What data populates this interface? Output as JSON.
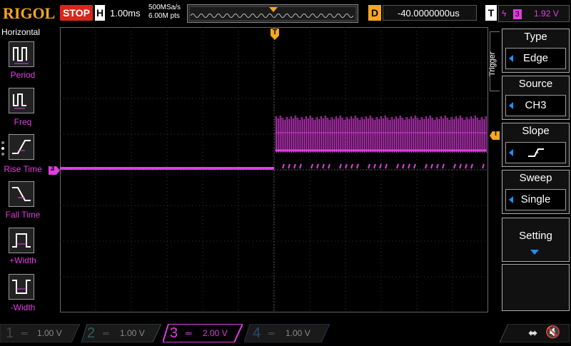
{
  "brand": "RIGOL",
  "run_state": "STOP",
  "timebase": {
    "label": "H",
    "value": "1.00ms",
    "sample_rate": "500MSa/s",
    "mem_depth": "6.00M pts"
  },
  "delay": {
    "label": "D",
    "value": "-40.0000000us"
  },
  "trigger_status": {
    "label": "T",
    "channel": "3",
    "level": "1.92 V"
  },
  "left_panel": {
    "title": "Horizontal",
    "items": [
      {
        "label": "Period"
      },
      {
        "label": "Freq"
      },
      {
        "label": "Rise Time"
      },
      {
        "label": "Fall Time"
      },
      {
        "label": "+Width"
      },
      {
        "label": "-Width"
      }
    ]
  },
  "trigger_menu": {
    "title": "Trigger",
    "items": [
      {
        "title": "Type",
        "value": "Edge"
      },
      {
        "title": "Source",
        "value": "CH3"
      },
      {
        "title": "Slope",
        "value": ""
      },
      {
        "title": "Sweep",
        "value": "Single"
      },
      {
        "title": "Setting",
        "value": ""
      }
    ]
  },
  "channels": [
    {
      "num": "1",
      "scale": "1.00 V",
      "active": false
    },
    {
      "num": "2",
      "scale": "1.00 V",
      "active": false
    },
    {
      "num": "3",
      "scale": "2.00 V",
      "active": true
    },
    {
      "num": "4",
      "scale": "1.00 V",
      "active": false
    }
  ],
  "markers": {
    "trigger_pos": "T",
    "channel_marker": "3"
  },
  "colors": {
    "ch3": "#e03ee0",
    "trigger": "#f5a623",
    "accent_blue": "#1e90ff",
    "stop": "#d9261c",
    "grid": "#3a3a3a"
  }
}
